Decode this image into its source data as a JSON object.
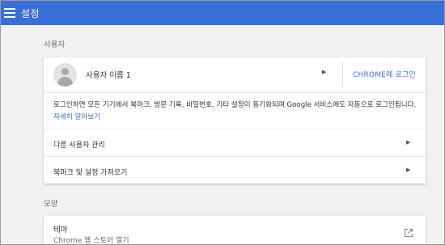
{
  "header": {
    "title": "설정",
    "menu_icon": "menu-icon",
    "color": "#3b6fd8"
  },
  "people": {
    "section_label": "사용자",
    "profile_name": "사용자 이름 1",
    "signin_label": "CHROME에 로그인",
    "description_text": "로그인하면 모든 기기에서 북마크, 방문 기록, 비밀번호, 기타 설정이 동기화되며 Google 서비스에도 자동으로 로그인됩니다. ",
    "learn_more": "자세히 알아보기",
    "rows": [
      {
        "label": "다른 사용자 관리"
      },
      {
        "label": "북마크 및 설정 가져오기"
      }
    ]
  },
  "appearance": {
    "section_label": "모양",
    "theme_title": "테마",
    "theme_subtitle": "Chrome 웹 스토어 열기",
    "open_icon": "external-link-icon"
  },
  "colors": {
    "accent": "#3b6fd8",
    "page_bg": "#f1f1f1",
    "card_bg": "#ffffff"
  }
}
